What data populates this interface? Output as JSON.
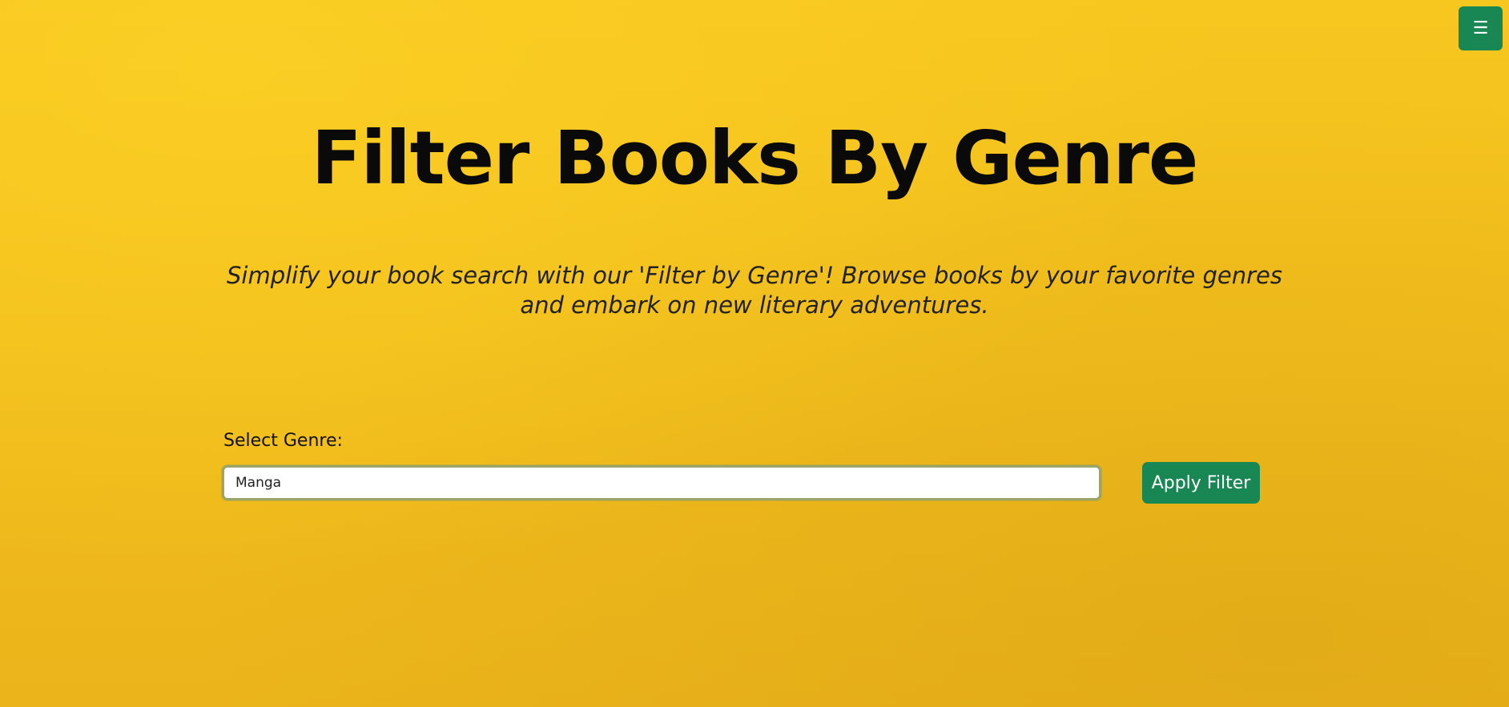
{
  "header": {
    "menu_icon": "☰"
  },
  "hero": {
    "title": "Filter Books By Genre",
    "subtitle": "Simplify your book search with our 'Filter by Genre'! Browse books by your favorite genres and embark on new literary adventures."
  },
  "filter": {
    "label": "Select Genre:",
    "value": "Manga",
    "apply_label": "Apply Filter"
  },
  "colors": {
    "background": "#f2bf1e",
    "button": "#198754",
    "button_text": "#ffffff"
  }
}
